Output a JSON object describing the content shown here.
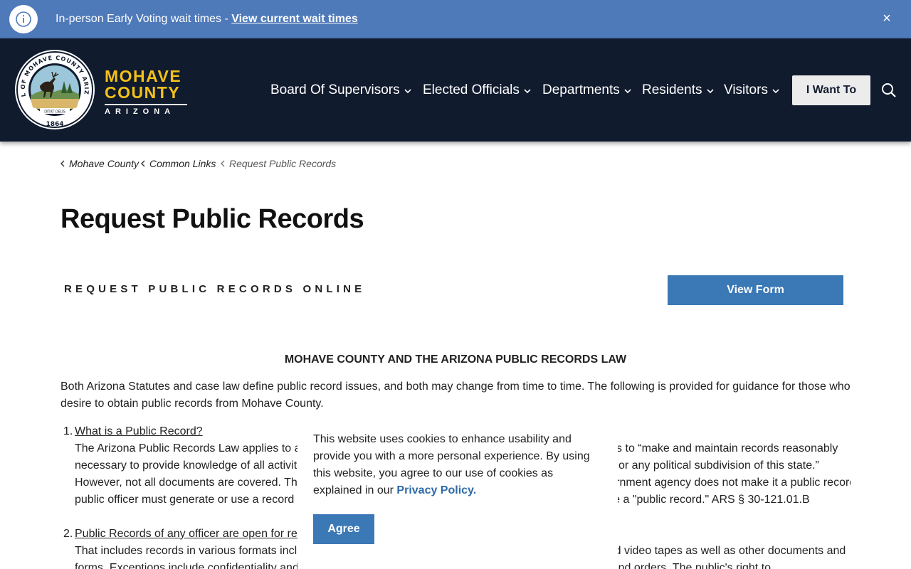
{
  "alert": {
    "message": "In-person Early Voting wait times - ",
    "link": "View current wait times",
    "close": "×"
  },
  "header": {
    "seal_text_top": "SEAL OF MOHAVE COUNTY ARIZONA",
    "seal_motto": "DITAT DEUS",
    "seal_year": "1864",
    "wordmark_1": "MOHAVE",
    "wordmark_2": "COUNTY",
    "wordmark_3": "ARIZONA",
    "nav": [
      {
        "label": "Board Of Supervisors"
      },
      {
        "label": "Elected Officials"
      },
      {
        "label": "Departments"
      },
      {
        "label": "Residents"
      },
      {
        "label": "Visitors"
      }
    ],
    "i_want_to": "I Want To"
  },
  "breadcrumb": [
    {
      "label": "Mohave County"
    },
    {
      "label": "Common Links"
    },
    {
      "label": "Request Public Records"
    }
  ],
  "page_title": "Request Public Records",
  "request_online": "REQUEST PUBLIC RECORDS ONLINE",
  "view_form": "View Form",
  "law_heading": "MOHAVE COUNTY AND THE ARIZONA PUBLIC RECORDS LAW",
  "intro": "Both Arizona Statutes and case law define public record issues, and both may change from time to time. The following is provided for guidance for those who desire to obtain public records from Mohave County.",
  "list": [
    {
      "num": "1.",
      "heading": "What is a Public Record?",
      "lines": [
        "The Arizona Public Records Law applies to all public bodies and requires all public officials and public bodies to “make and maintain records reasonably",
        "necessary to provide knowledge of all activities they undertake that are supported by monies from this state or any political subdivision of this state.”",
        "However, not all documents are covered. The fact that a document is in the possession of or kept by a government agency does not make it a public record. A",
        "public officer must generate or use a record in the performance of his or her official duties in order for it to be a \"public record.\" ARS § 30-121.01.B"
      ]
    },
    {
      "num": "2.",
      "heading": "Public Records of any officer are open for review",
      "lines": [
        "That includes records in various formats including paper, electronic data, photographs, maps, film, audio and video tapes as well as other documents and",
        "forms. Exceptions include confidentiality and privacy laws, matters of state and county security, court rules and orders. The public's right to"
      ]
    }
  ],
  "cookie": {
    "text": "This website uses cookies to enhance usability and provide you with a more personal experience. By using this website, you agree to our use of cookies as explained in our ",
    "link": "Privacy Policy.",
    "agree": "Agree"
  },
  "colors": {
    "alert_bg": "#4f7ab9",
    "header_bg": "#111b2e",
    "wordmark": "#f2c11b",
    "button_blue": "#3b78b6"
  }
}
